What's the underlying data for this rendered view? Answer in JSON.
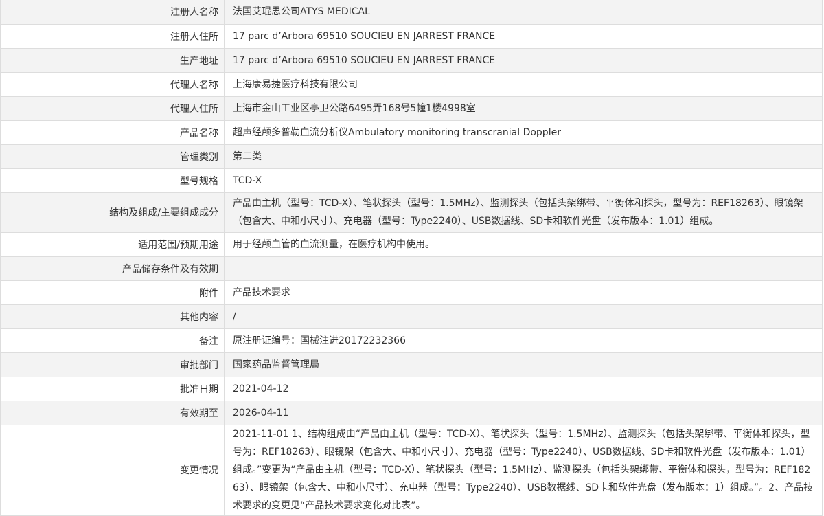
{
  "rows": [
    {
      "label": "注册人名称",
      "value": "法国艾琨思公司ATYS MEDICAL"
    },
    {
      "label": "注册人住所",
      "value": "17 parc d’Arbora 69510 SOUCIEU EN JARREST FRANCE"
    },
    {
      "label": "生产地址",
      "value": "17 parc d’Arbora 69510 SOUCIEU EN JARREST FRANCE"
    },
    {
      "label": "代理人名称",
      "value": "上海康易捷医疗科技有限公司"
    },
    {
      "label": "代理人住所",
      "value": "上海市金山工业区亭卫公路6495弄168号5幢1楼4998室"
    },
    {
      "label": "产品名称",
      "value": "超声经颅多普勒血流分析仪Ambulatory monitoring transcranial Doppler"
    },
    {
      "label": "管理类别",
      "value": "第二类"
    },
    {
      "label": "型号规格",
      "value": "TCD-X"
    },
    {
      "label": "结构及组成/主要组成成分",
      "value": "产品由主机（型号：TCD-X）、笔状探头（型号：1.5MHz）、监测探头（包括头架绑带、平衡体和探头，型号为：REF18263）、眼镜架（包含大、中和小尺寸）、充电器（型号：Type2240）、USB数据线、SD卡和软件光盘（发布版本：1.01）组成。"
    },
    {
      "label": "适用范围/预期用途",
      "value": "用于经颅血管的血流测量，在医疗机构中使用。"
    },
    {
      "label": "产品储存条件及有效期",
      "value": ""
    },
    {
      "label": "附件",
      "value": "产品技术要求"
    },
    {
      "label": "其他内容",
      "value": "/"
    },
    {
      "label": "备注",
      "value": "原注册证编号：国械注进20172232366"
    },
    {
      "label": "审批部门",
      "value": "国家药品监督管理局"
    },
    {
      "label": "批准日期",
      "value": "2021-04-12"
    },
    {
      "label": "有效期至",
      "value": "2026-04-11"
    },
    {
      "label": "变更情况",
      "value": "2021-11-01 1、结构组成由“产品由主机（型号：TCD-X）、笔状探头（型号：1.5MHz）、监测探头（包括头架绑带、平衡体和探头，型号为：REF18263）、眼镜架（包含大、中和小尺寸）、充电器（型号：Type2240）、USB数据线、SD卡和软件光盘（发布版本：1.01）组成。”变更为“产品由主机（型号：TCD-X）、笔状探头（型号：1.5MHz）、监测探头（包括头架绑带、平衡体和探头，型号为：REF18263）、眼镜架（包含大、中和小尺寸）、充电器（型号：Type2240）、USB数据线、SD卡和软件光盘（发布版本：1）组成。”。2、产品技术要求的变更见“产品技术要求变化对比表”。"
    }
  ]
}
